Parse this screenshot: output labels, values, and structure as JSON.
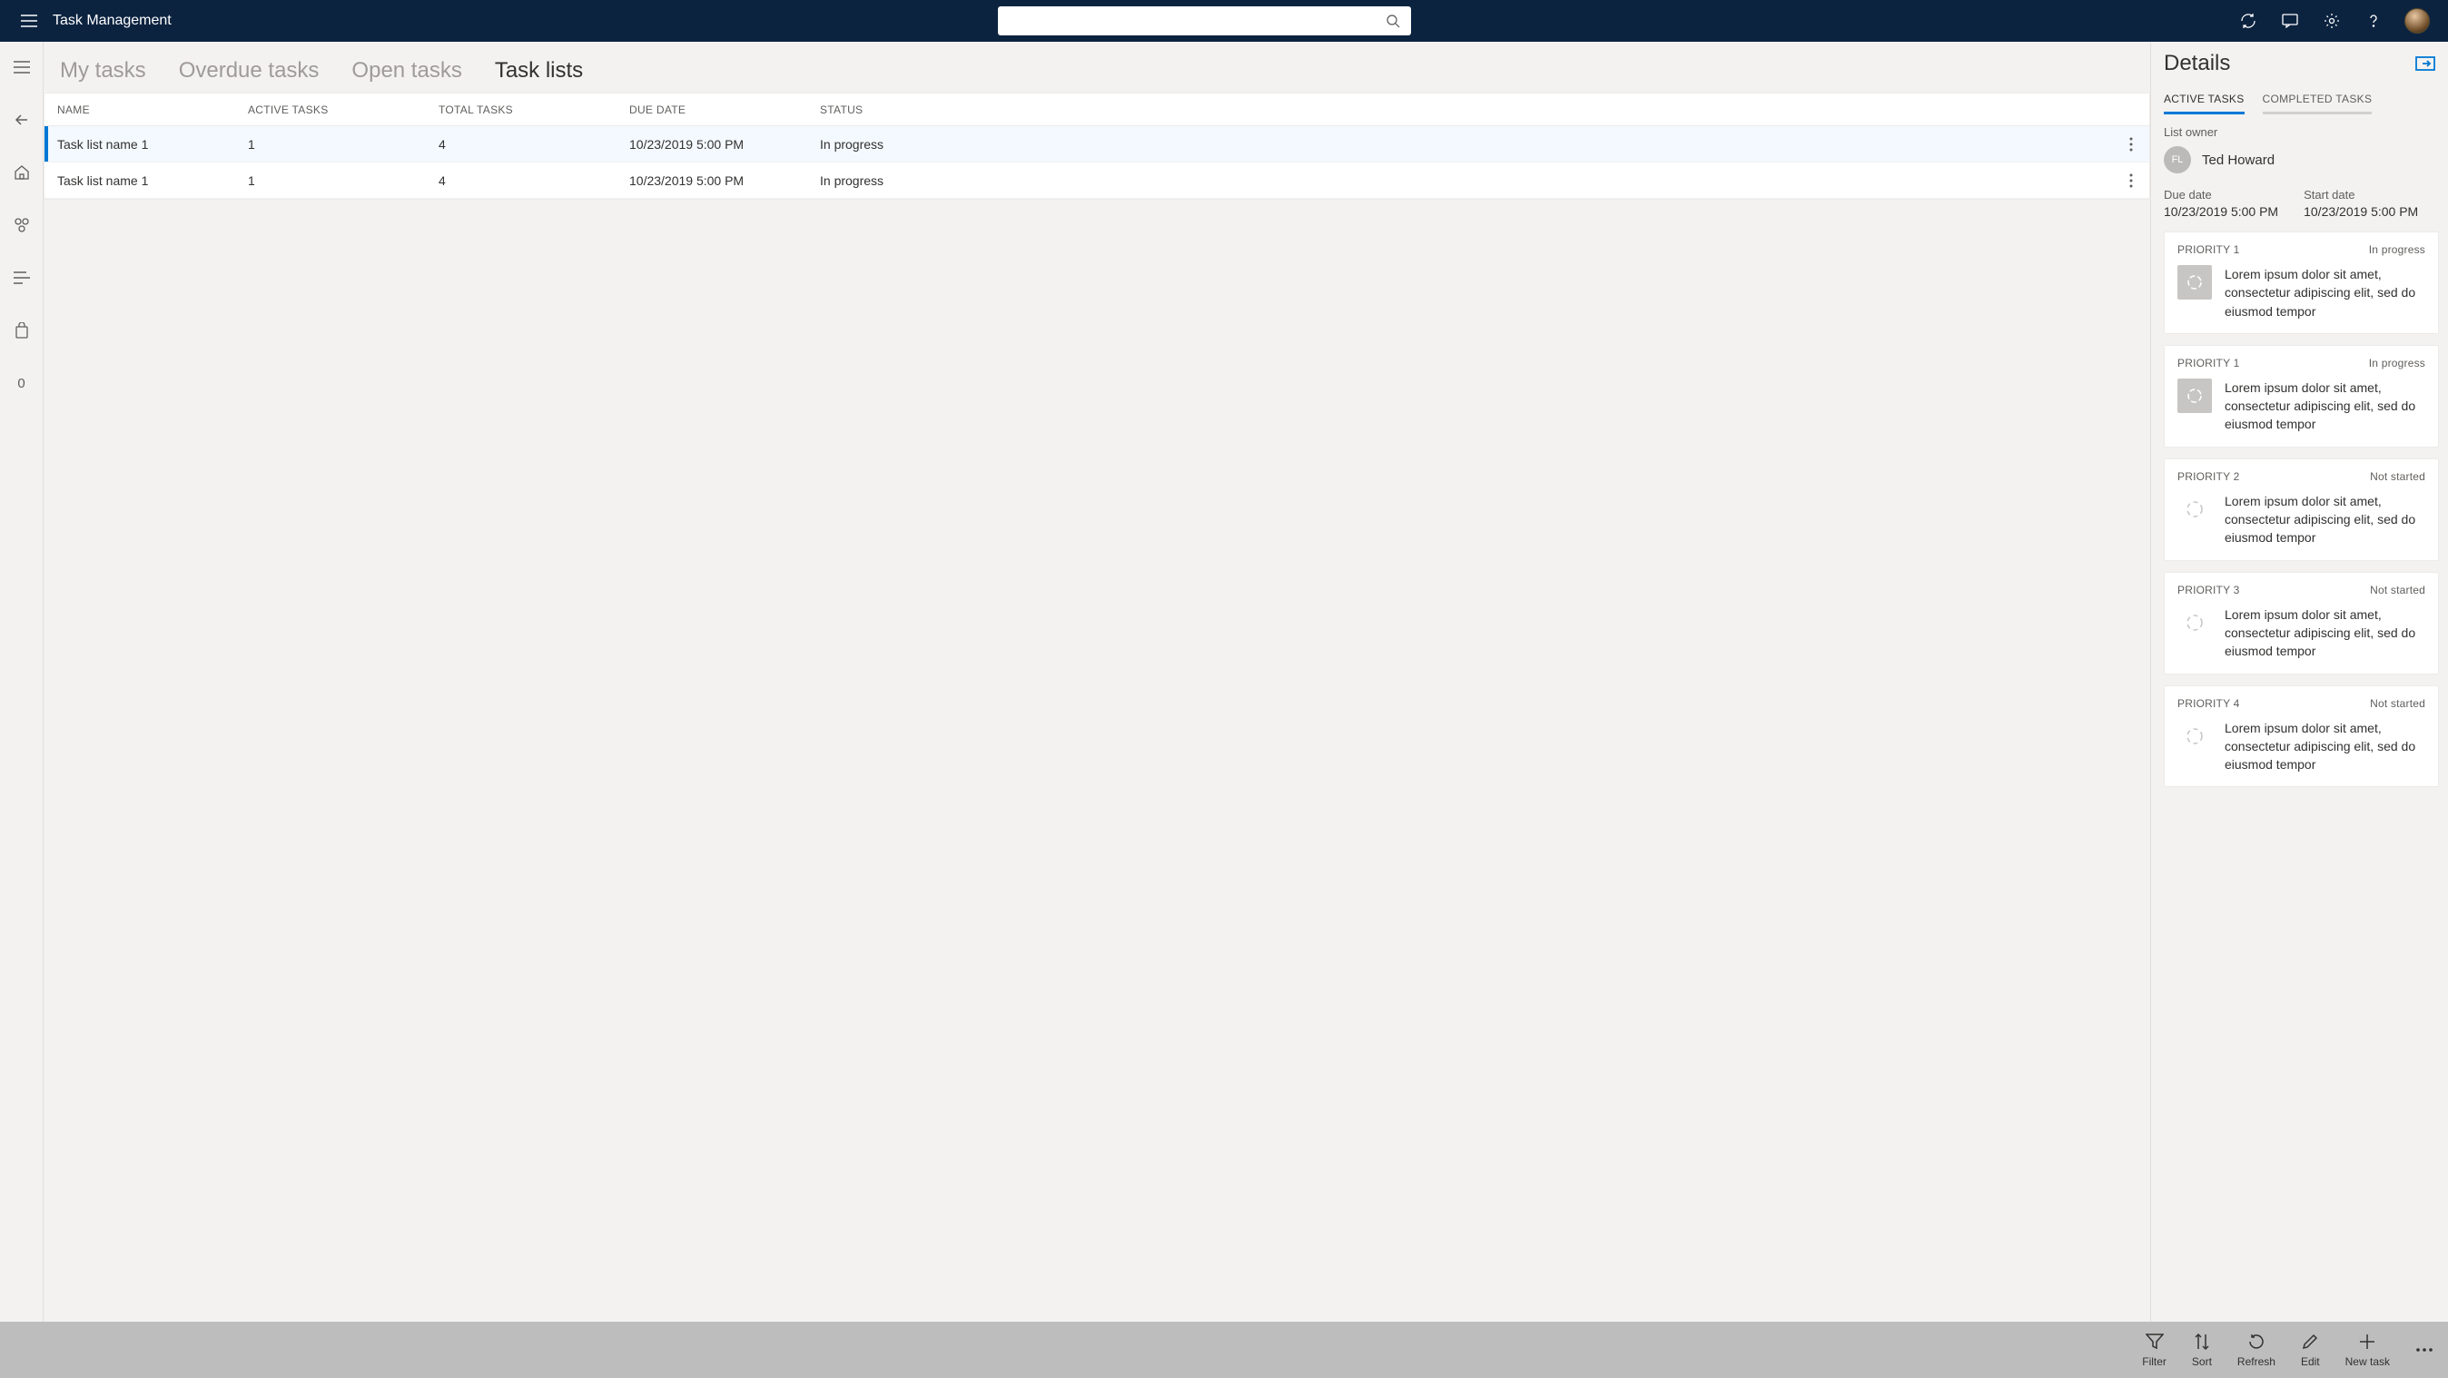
{
  "header": {
    "title": "Task Management",
    "search_placeholder": ""
  },
  "leftnav": {
    "zero_label": "0"
  },
  "tabs": {
    "my_tasks": "My tasks",
    "overdue": "Overdue tasks",
    "open": "Open tasks",
    "task_lists": "Task lists"
  },
  "table": {
    "headers": {
      "name": "NAME",
      "active": "ACTIVE TASKS",
      "total": "TOTAL TASKS",
      "due": "DUE DATE",
      "status": "STATUS"
    },
    "rows": [
      {
        "name": "Task list name 1",
        "active": "1",
        "total": "4",
        "due": "10/23/2019 5:00 PM",
        "status": "In progress"
      },
      {
        "name": "Task list name 1",
        "active": "1",
        "total": "4",
        "due": "10/23/2019 5:00 PM",
        "status": "In progress"
      }
    ]
  },
  "details": {
    "title": "Details",
    "tab_active": "ACTIVE TASKS",
    "tab_completed": "COMPLETED TASKS",
    "owner_label": "List owner",
    "owner_initials": "FL",
    "owner_name": "Ted Howard",
    "due_label": "Due date",
    "due_value": "10/23/2019 5:00 PM",
    "start_label": "Start date",
    "start_value": "10/23/2019 5:00 PM",
    "tasks": [
      {
        "priority": "PRIORITY 1",
        "status": "In progress",
        "desc": "Lorem ipsum dolor sit amet, consectetur adipiscing elit, sed do eiusmod tempor",
        "style": "solid"
      },
      {
        "priority": "PRIORITY 1",
        "status": "In progress",
        "desc": "Lorem ipsum dolor sit amet, consectetur adipiscing elit, sed do eiusmod tempor",
        "style": "solid"
      },
      {
        "priority": "PRIORITY 2",
        "status": "Not started",
        "desc": "Lorem ipsum dolor sit amet, consectetur adipiscing elit, sed do eiusmod tempor",
        "style": "outline"
      },
      {
        "priority": "PRIORITY 3",
        "status": "Not started",
        "desc": "Lorem ipsum dolor sit amet, consectetur adipiscing elit, sed do eiusmod tempor",
        "style": "outline"
      },
      {
        "priority": "PRIORITY 4",
        "status": "Not started",
        "desc": "Lorem ipsum dolor sit amet, consectetur adipiscing elit, sed do eiusmod tempor",
        "style": "outline"
      }
    ]
  },
  "footer": {
    "filter": "Filter",
    "sort": "Sort",
    "refresh": "Refresh",
    "edit": "Edit",
    "new_task": "New task"
  }
}
